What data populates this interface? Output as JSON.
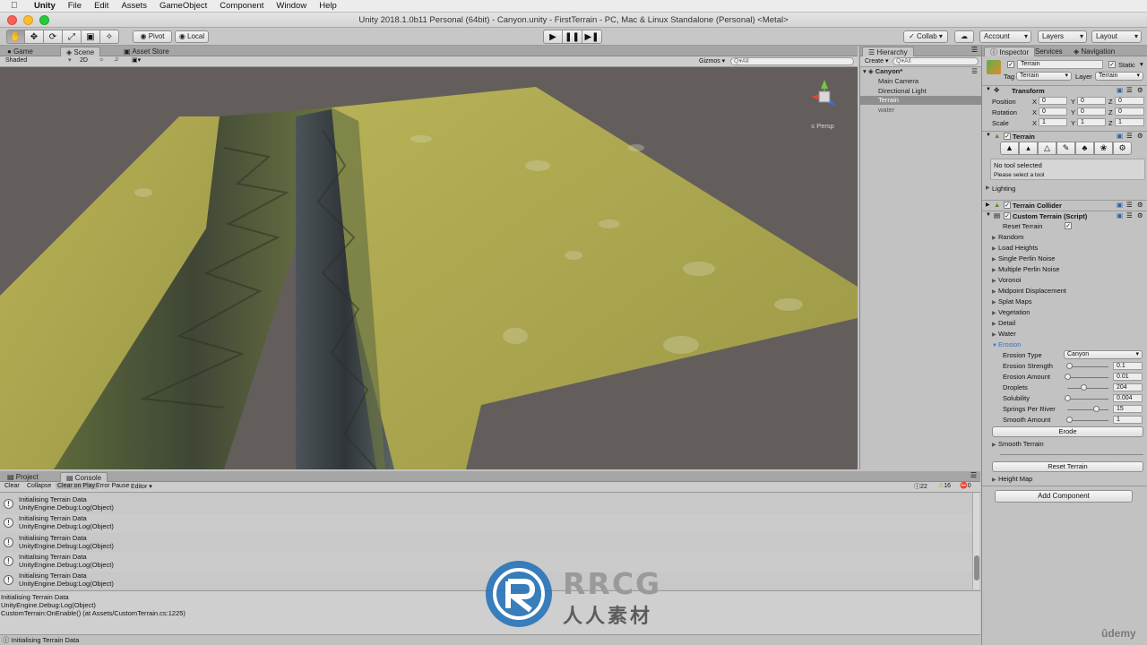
{
  "menubar": {
    "apple": "",
    "app": "Unity",
    "items": [
      "File",
      "Edit",
      "Assets",
      "GameObject",
      "Component",
      "Window",
      "Help"
    ]
  },
  "window_title": "Unity 2018.1.0b11 Personal (64bit) - Canyon.unity - FirstTerrain - PC, Mac & Linux Standalone (Personal) <Metal>",
  "toolbar": {
    "pivot": "Pivot",
    "local": "Local",
    "collab": "Collab ▾",
    "account": "Account",
    "layers": "Layers",
    "layout": "Layout"
  },
  "scene_tabs": [
    "Game",
    "Scene",
    "Asset Store"
  ],
  "scene_bar": {
    "shading": "Shaded",
    "mode2d": "2D",
    "gizmos": "Gizmos ▾",
    "search_placeholder": "Q▾All",
    "persp": "≤ Persp"
  },
  "hierarchy": {
    "tab": "Hierarchy",
    "create": "Create ▾",
    "search_placeholder": "Q▾All",
    "scene": "Canyon*",
    "items": [
      "Main Camera",
      "Directional Light",
      "Terrain",
      "water"
    ],
    "selected": "Terrain"
  },
  "inspector": {
    "tabs": [
      "Inspector",
      "Services",
      "Navigation"
    ],
    "object_name": "Terrain",
    "static": "Static",
    "tag_label": "Tag",
    "tag": "Terrain",
    "layer_label": "Layer",
    "layer": "Terrain",
    "transform": {
      "title": "Transform",
      "rows": [
        {
          "label": "Position",
          "x": "0",
          "y": "0",
          "z": "0"
        },
        {
          "label": "Rotation",
          "x": "0",
          "y": "0",
          "z": "0"
        },
        {
          "label": "Scale",
          "x": "1",
          "y": "1",
          "z": "1"
        }
      ],
      "axes": [
        "X",
        "Y",
        "Z"
      ]
    },
    "terrain": {
      "title": "Terrain",
      "no_tool": "No tool selected",
      "please": "Please select a tool",
      "lighting": "Lighting"
    },
    "terrain_collider": "Terrain Collider",
    "custom_terrain": {
      "title": "Custom Terrain (Script)",
      "reset_terrain_label": "Reset Terrain",
      "folds": [
        "Random",
        "Load Heights",
        "Single Perlin Noise",
        "Multiple Perlin Noise",
        "Voronoi",
        "Midpoint Displacement",
        "Splat Maps",
        "Vegetation",
        "Detail",
        "Water"
      ],
      "erosion": "Erosion",
      "erosion_type_label": "Erosion Type",
      "erosion_type": "Canyon",
      "params": [
        {
          "label": "Erosion Strength",
          "value": "0.1",
          "fraction": 0.05
        },
        {
          "label": "Erosion Amount",
          "value": "0.01",
          "fraction": 0.0
        },
        {
          "label": "Droplets",
          "value": "204",
          "fraction": 0.4
        },
        {
          "label": "Solubility",
          "value": "0.004",
          "fraction": 0.0
        },
        {
          "label": "Springs Per River",
          "value": "15",
          "fraction": 0.7
        },
        {
          "label": "Smooth Amount",
          "value": "1",
          "fraction": 0.05
        }
      ],
      "erode_button": "Erode",
      "smooth_terrain": "Smooth Terrain",
      "reset_button": "Reset Terrain",
      "height_map": "Height Map"
    },
    "add_component": "Add Component"
  },
  "console": {
    "tabs": [
      "Project",
      "Console"
    ],
    "buttons": [
      "Clear",
      "Collapse",
      "Clear on Play",
      "Error Pause",
      "Editor ▾"
    ],
    "counts": {
      "log": "22",
      "warn": "16",
      "error": "0"
    },
    "entries": [
      {
        "line1": "Initialising Terrain Data",
        "line2": "UnityEngine.Debug:Log(Object)"
      },
      {
        "line1": "Initialising Terrain Data",
        "line2": "UnityEngine.Debug:Log(Object)"
      },
      {
        "line1": "Initialising Terrain Data",
        "line2": "UnityEngine.Debug:Log(Object)"
      },
      {
        "line1": "Initialising Terrain Data",
        "line2": "UnityEngine.Debug:Log(Object)"
      },
      {
        "line1": "Initialising Terrain Data",
        "line2": "UnityEngine.Debug:Log(Object)"
      }
    ],
    "detail": [
      "Initialising Terrain Data",
      "UnityEngine.Debug:Log(Object)",
      "CustomTerrain:OnEnable() (at Assets/CustomTerrain.cs:1225)"
    ],
    "status": "Initialising Terrain Data"
  },
  "watermark": {
    "rrcg": "RRCG",
    "cn": "人人素材",
    "udemy": "ûdemy"
  }
}
